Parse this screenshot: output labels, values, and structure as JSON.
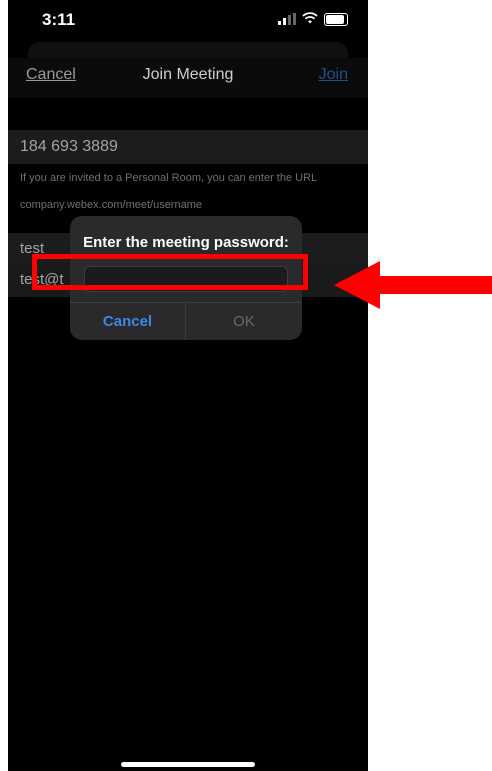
{
  "status": {
    "time": "3:11"
  },
  "nav": {
    "cancel": "Cancel",
    "title": "Join Meeting",
    "join": "Join"
  },
  "form": {
    "meeting_number": "184 693 3889",
    "hint1": "If you are invited to a Personal Room, you can enter the URL",
    "hint2": "company.webex.com/meet/username",
    "name": "test",
    "email": "test@t"
  },
  "dialog": {
    "title": "Enter the meeting password:",
    "password_value": "",
    "cancel": "Cancel",
    "ok": "OK"
  },
  "annotation": {
    "color": "#ff0000"
  },
  "icons": [
    "signal-icon",
    "wifi-icon",
    "battery-icon",
    "arrow-icon"
  ]
}
